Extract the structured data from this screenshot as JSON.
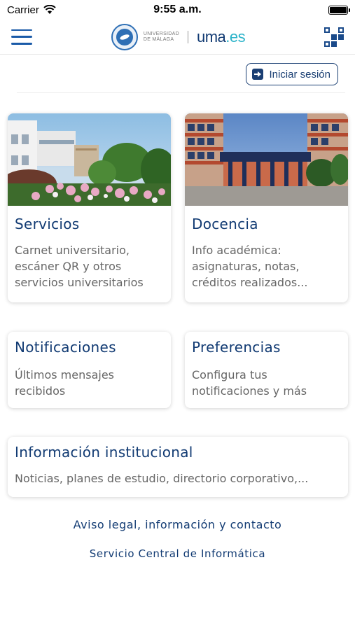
{
  "status_bar": {
    "carrier": "Carrier",
    "time": "9:55 a.m.",
    "battery_level": 1.0
  },
  "header": {
    "university_name_line1": "UNIVERSIDAD",
    "university_name_line2": "DE MÁLAGA",
    "logo_text_main": "uma",
    "logo_text_suffix": ".es",
    "icons": {
      "menu": "hamburger-menu-icon",
      "qr": "qr-code-icon"
    },
    "colors": {
      "primary": "#123b73",
      "accent": "#2bb3c9",
      "menu": "#1a5aa8"
    }
  },
  "login": {
    "label": "Iniciar sesión",
    "icon": "login-icon"
  },
  "cards": {
    "servicios": {
      "title": "Servicios",
      "description": "Carnet universitario, escáner QR y otros servicios universitarios"
    },
    "docencia": {
      "title": "Docencia",
      "description": "Info académica: asignaturas, notas, créditos realizados..."
    },
    "notificaciones": {
      "title": "Notificaciones",
      "description": "Últimos mensajes recibidos"
    },
    "preferencias": {
      "title": "Preferencias",
      "description": "Configura tus notificaciones y más"
    },
    "informacion": {
      "title": "Información institucional",
      "description": "Noticias, planes de estudio, directorio corporativo,..."
    }
  },
  "footer": {
    "legal_link": "Aviso legal, información y contacto",
    "service_link": "Servicio Central de Informática"
  }
}
